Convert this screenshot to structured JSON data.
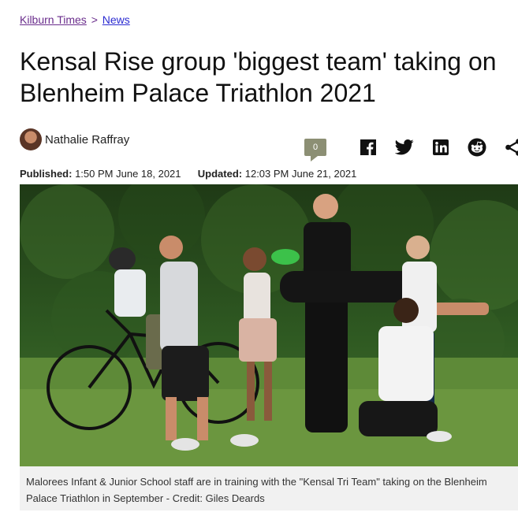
{
  "breadcrumb": {
    "home": "Kilburn Times",
    "separator": ">",
    "section": "News"
  },
  "article": {
    "title": "Kensal Rise group 'biggest team' taking on Blenheim Palace Triathlon 2021",
    "author": "Nathalie Raffray",
    "comment_count": "0",
    "published_label": "Published:",
    "published_value": "1:50 PM June 18, 2021",
    "updated_label": "Updated:",
    "updated_value": "12:03 PM June 21, 2021",
    "caption": "Malorees Infant & Junior School staff are in training with the \"Kensal Tri Team\" taking on the Blenheim Palace Triathlon in September - Credit: Giles Deards"
  },
  "share_icons": [
    "facebook-icon",
    "twitter-icon",
    "linkedin-icon",
    "reddit-icon",
    "share-icon"
  ],
  "colors": {
    "link_visited": "#6a2d8c",
    "link": "#2b2bd1",
    "comment_badge": "#8c8f74",
    "caption_bg": "#f1f1f1"
  }
}
